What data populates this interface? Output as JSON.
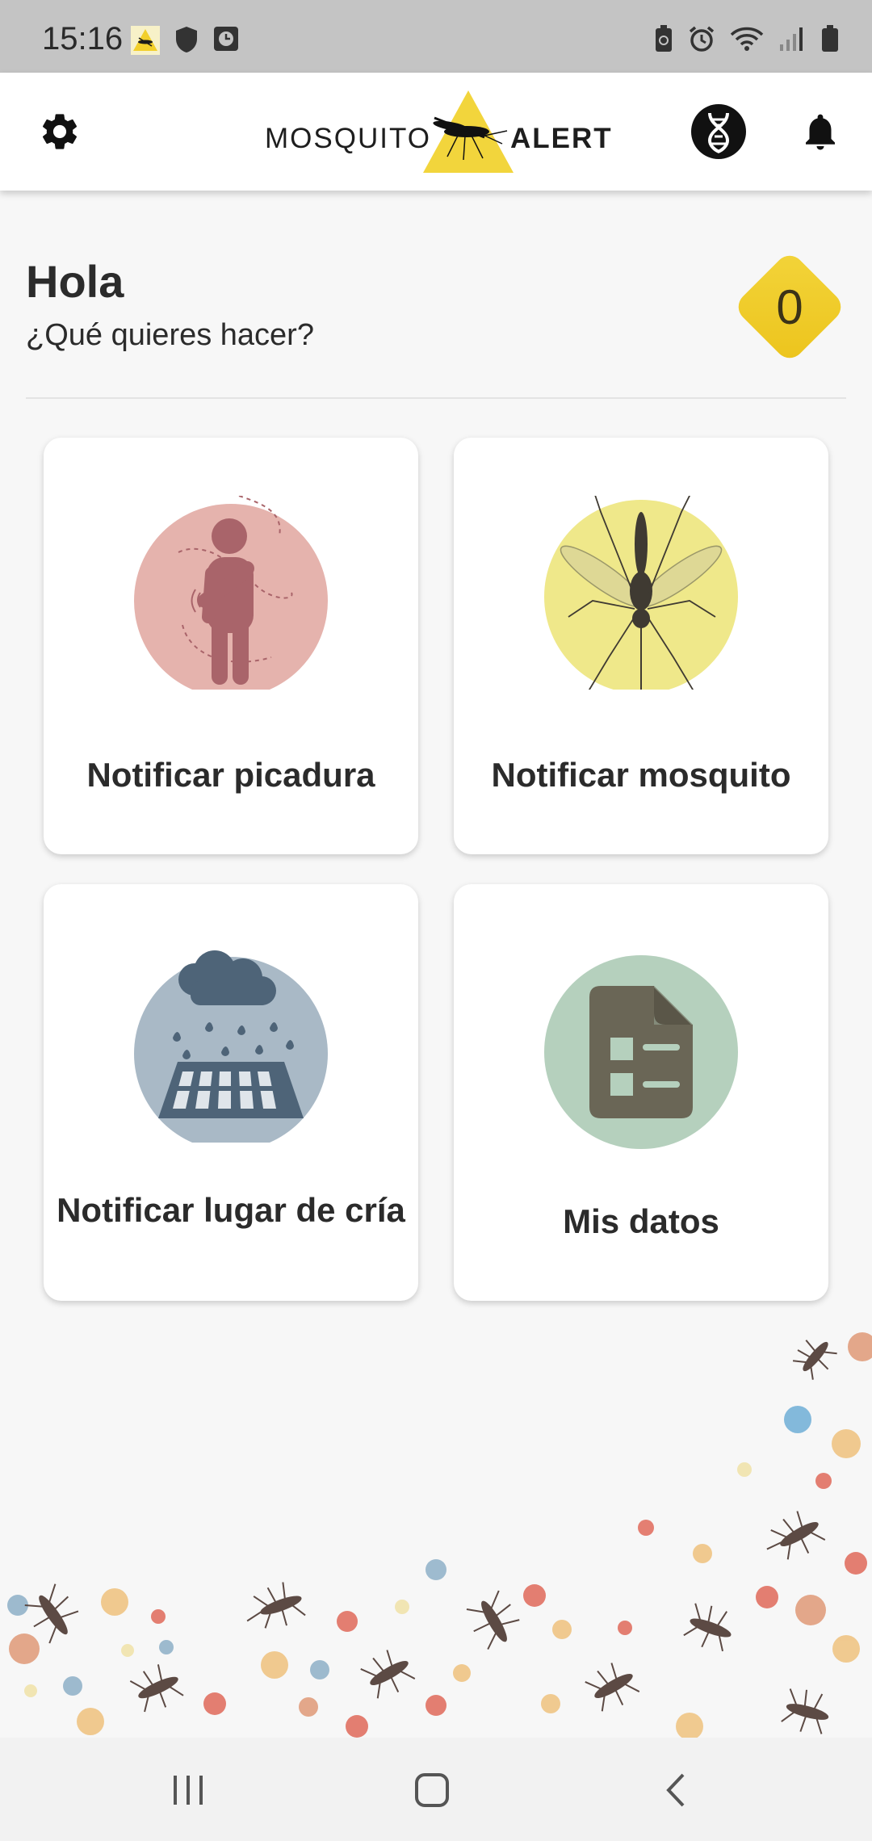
{
  "status_bar": {
    "time": "15:16",
    "left_icons": [
      "mosquito-alert-notification-icon",
      "shield-icon",
      "clock-app-icon"
    ],
    "right_icons": [
      "battery-saver-icon",
      "alarm-icon",
      "wifi-icon",
      "signal-icon",
      "battery-icon"
    ]
  },
  "app_bar": {
    "logo_left": "MOSQUITO",
    "logo_right": "ALERT",
    "icons": [
      "settings-gear-icon",
      "dna-icon",
      "notifications-bell-icon"
    ]
  },
  "greeting": {
    "title": "Hola",
    "subtitle": "¿Qué quieres hacer?",
    "points": "0"
  },
  "cards": [
    {
      "label": "Notificar picadura",
      "icon": "bite-person-icon",
      "color": "#e5b3ad"
    },
    {
      "label": "Notificar mosquito",
      "icon": "mosquito-icon",
      "color": "#efe88a"
    },
    {
      "label": "Notificar lugar de cría",
      "icon": "breeding-site-drain-icon",
      "color": "#a9b9c6"
    },
    {
      "label": "Mis datos",
      "icon": "document-list-icon",
      "color": "#b5d0bd"
    }
  ],
  "colors": {
    "accent_yellow": "#f0cb25",
    "status_bar": "#c4c4c4",
    "background": "#f7f7f7"
  },
  "nav_bar": {
    "icons": [
      "recent-apps-icon",
      "home-icon",
      "back-icon"
    ]
  }
}
